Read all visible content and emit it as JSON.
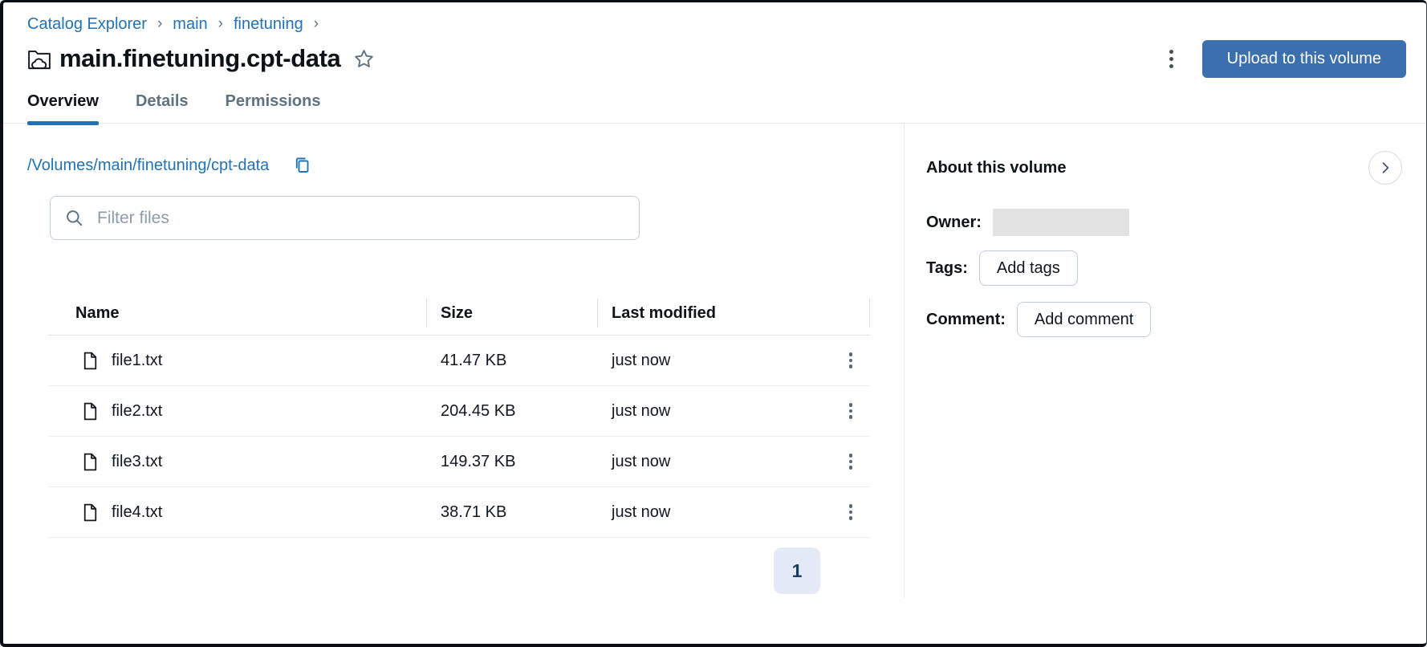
{
  "breadcrumb": {
    "items": [
      "Catalog Explorer",
      "main",
      "finetuning"
    ],
    "separator": "›"
  },
  "header": {
    "title": "main.finetuning.cpt-data",
    "upload_button": "Upload to this volume"
  },
  "tabs": [
    {
      "label": "Overview",
      "active": true
    },
    {
      "label": "Details",
      "active": false
    },
    {
      "label": "Permissions",
      "active": false
    }
  ],
  "main": {
    "path": "/Volumes/main/finetuning/cpt-data",
    "filter_placeholder": "Filter files",
    "table": {
      "columns": [
        "Name",
        "Size",
        "Last modified"
      ],
      "rows": [
        {
          "name": "file1.txt",
          "size": "41.47 KB",
          "modified": "just now"
        },
        {
          "name": "file2.txt",
          "size": "204.45 KB",
          "modified": "just now"
        },
        {
          "name": "file3.txt",
          "size": "149.37 KB",
          "modified": "just now"
        },
        {
          "name": "file4.txt",
          "size": "38.71 KB",
          "modified": "just now"
        }
      ]
    },
    "pagination": {
      "current_page": "1"
    }
  },
  "sidebar": {
    "heading": "About this volume",
    "owner_label": "Owner:",
    "tags_label": "Tags:",
    "add_tags_button": "Add tags",
    "comment_label": "Comment:",
    "add_comment_button": "Add comment"
  },
  "icons": {
    "volume": "folder-with-cloud",
    "star": "star-outline",
    "kebab": "vertical-three-dots",
    "copy": "copy-pages",
    "search": "magnifier",
    "file": "document-folded-corner",
    "chevron_right": "›",
    "breadcrumb_separator": "›"
  },
  "colors": {
    "link": "#2272B4",
    "primary_button": "#3B70AE",
    "tab_underline": "#2272B4",
    "pagination_bg": "#E3EAF6",
    "pagination_text": "#1D3C62"
  }
}
